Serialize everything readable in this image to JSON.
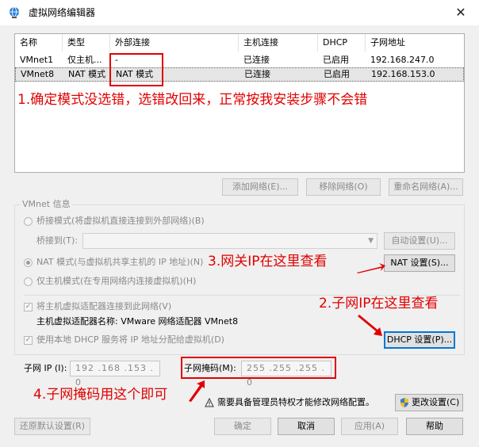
{
  "window": {
    "title": "虚拟网络编辑器",
    "close_glyph": "✕"
  },
  "table": {
    "headers": [
      "名称",
      "类型",
      "外部连接",
      "主机连接",
      "DHCP",
      "子网地址"
    ],
    "rows": [
      [
        "VMnet1",
        "仅主机...",
        "-",
        "已连接",
        "已启用",
        "192.168.247.0"
      ],
      [
        "VMnet8",
        "NAT 模式",
        "NAT 模式",
        "已连接",
        "已启用",
        "192.168.153.0"
      ]
    ]
  },
  "table_buttons": {
    "add": "添加网络(E)...",
    "remove": "移除网络(O)",
    "rename": "重命名网络(A)..."
  },
  "vmnet_info": {
    "group_label": "VMnet 信息",
    "bridge_mode": "桥接模式(将虚拟机直接连接到外部网络)(B)",
    "bridge_to": "桥接到(T):",
    "auto_settings": "自动设置(U)...",
    "nat_mode": "NAT 模式(与虚拟机共享主机的 IP 地址)(N)",
    "nat_settings": "NAT 设置(S)...",
    "host_only": "仅主机模式(在专用网络内连接虚拟机)(H)",
    "connect_adapter": "将主机虚拟适配器连接到此网络(V)",
    "adapter_name": "主机虚拟适配器名称: VMware 网络适配器 VMnet8",
    "use_dhcp": "使用本地 DHCP 服务将 IP 地址分配给虚拟机(D)",
    "dhcp_settings": "DHCP 设置(P)...",
    "subnet_ip_label": "子网 IP (I):",
    "subnet_ip": "192 .168 .153 . 0",
    "subnet_mask_label": "子网掩码(M):",
    "subnet_mask": "255 .255 .255 . 0"
  },
  "footer": {
    "admin_notice": "需要具备管理员特权才能修改网络配置。",
    "change_settings": "更改设置(C)",
    "restore_defaults": "还原默认设置(R)",
    "ok": "确定",
    "cancel": "取消",
    "apply": "应用(A)",
    "help": "帮助"
  },
  "annotations": {
    "a1": "1.确定模式没选错，选错改回来，正常按我安装步骤不会错",
    "a2": "2.子网IP在这里查看",
    "a3": "3.网关IP在这里查看",
    "a4": "4.子网掩码用这个即可"
  },
  "colors": {
    "annotation_red": "#e00000",
    "accent_blue": "#0078d7"
  }
}
